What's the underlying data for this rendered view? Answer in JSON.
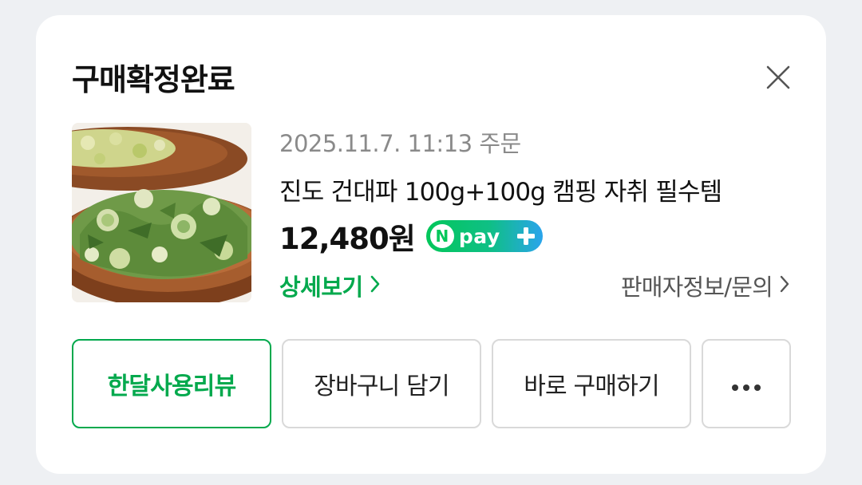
{
  "card": {
    "title": "구매확정완료",
    "close_icon": "close-icon"
  },
  "product": {
    "order_date": "2025.11.7. 11:13 주문",
    "name": "진도 건대파 100g+100g 캠핑 자취 필수템",
    "price": "12,480원",
    "payment_badge": {
      "n_letter": "N",
      "text": "pay",
      "plus_icon": "plus-icon"
    },
    "image": "dried-green-onion-photo"
  },
  "links": {
    "detail": "상세보기",
    "seller": "판매자정보/문의"
  },
  "actions": {
    "review": "한달사용리뷰",
    "cart": "장바구니 담기",
    "buy_now": "바로 구매하기",
    "more_icon": "more-dots-icon"
  },
  "colors": {
    "accent_green": "#03a94d",
    "npay_green": "#03c75a",
    "npay_blue": "#2aa4ec"
  }
}
